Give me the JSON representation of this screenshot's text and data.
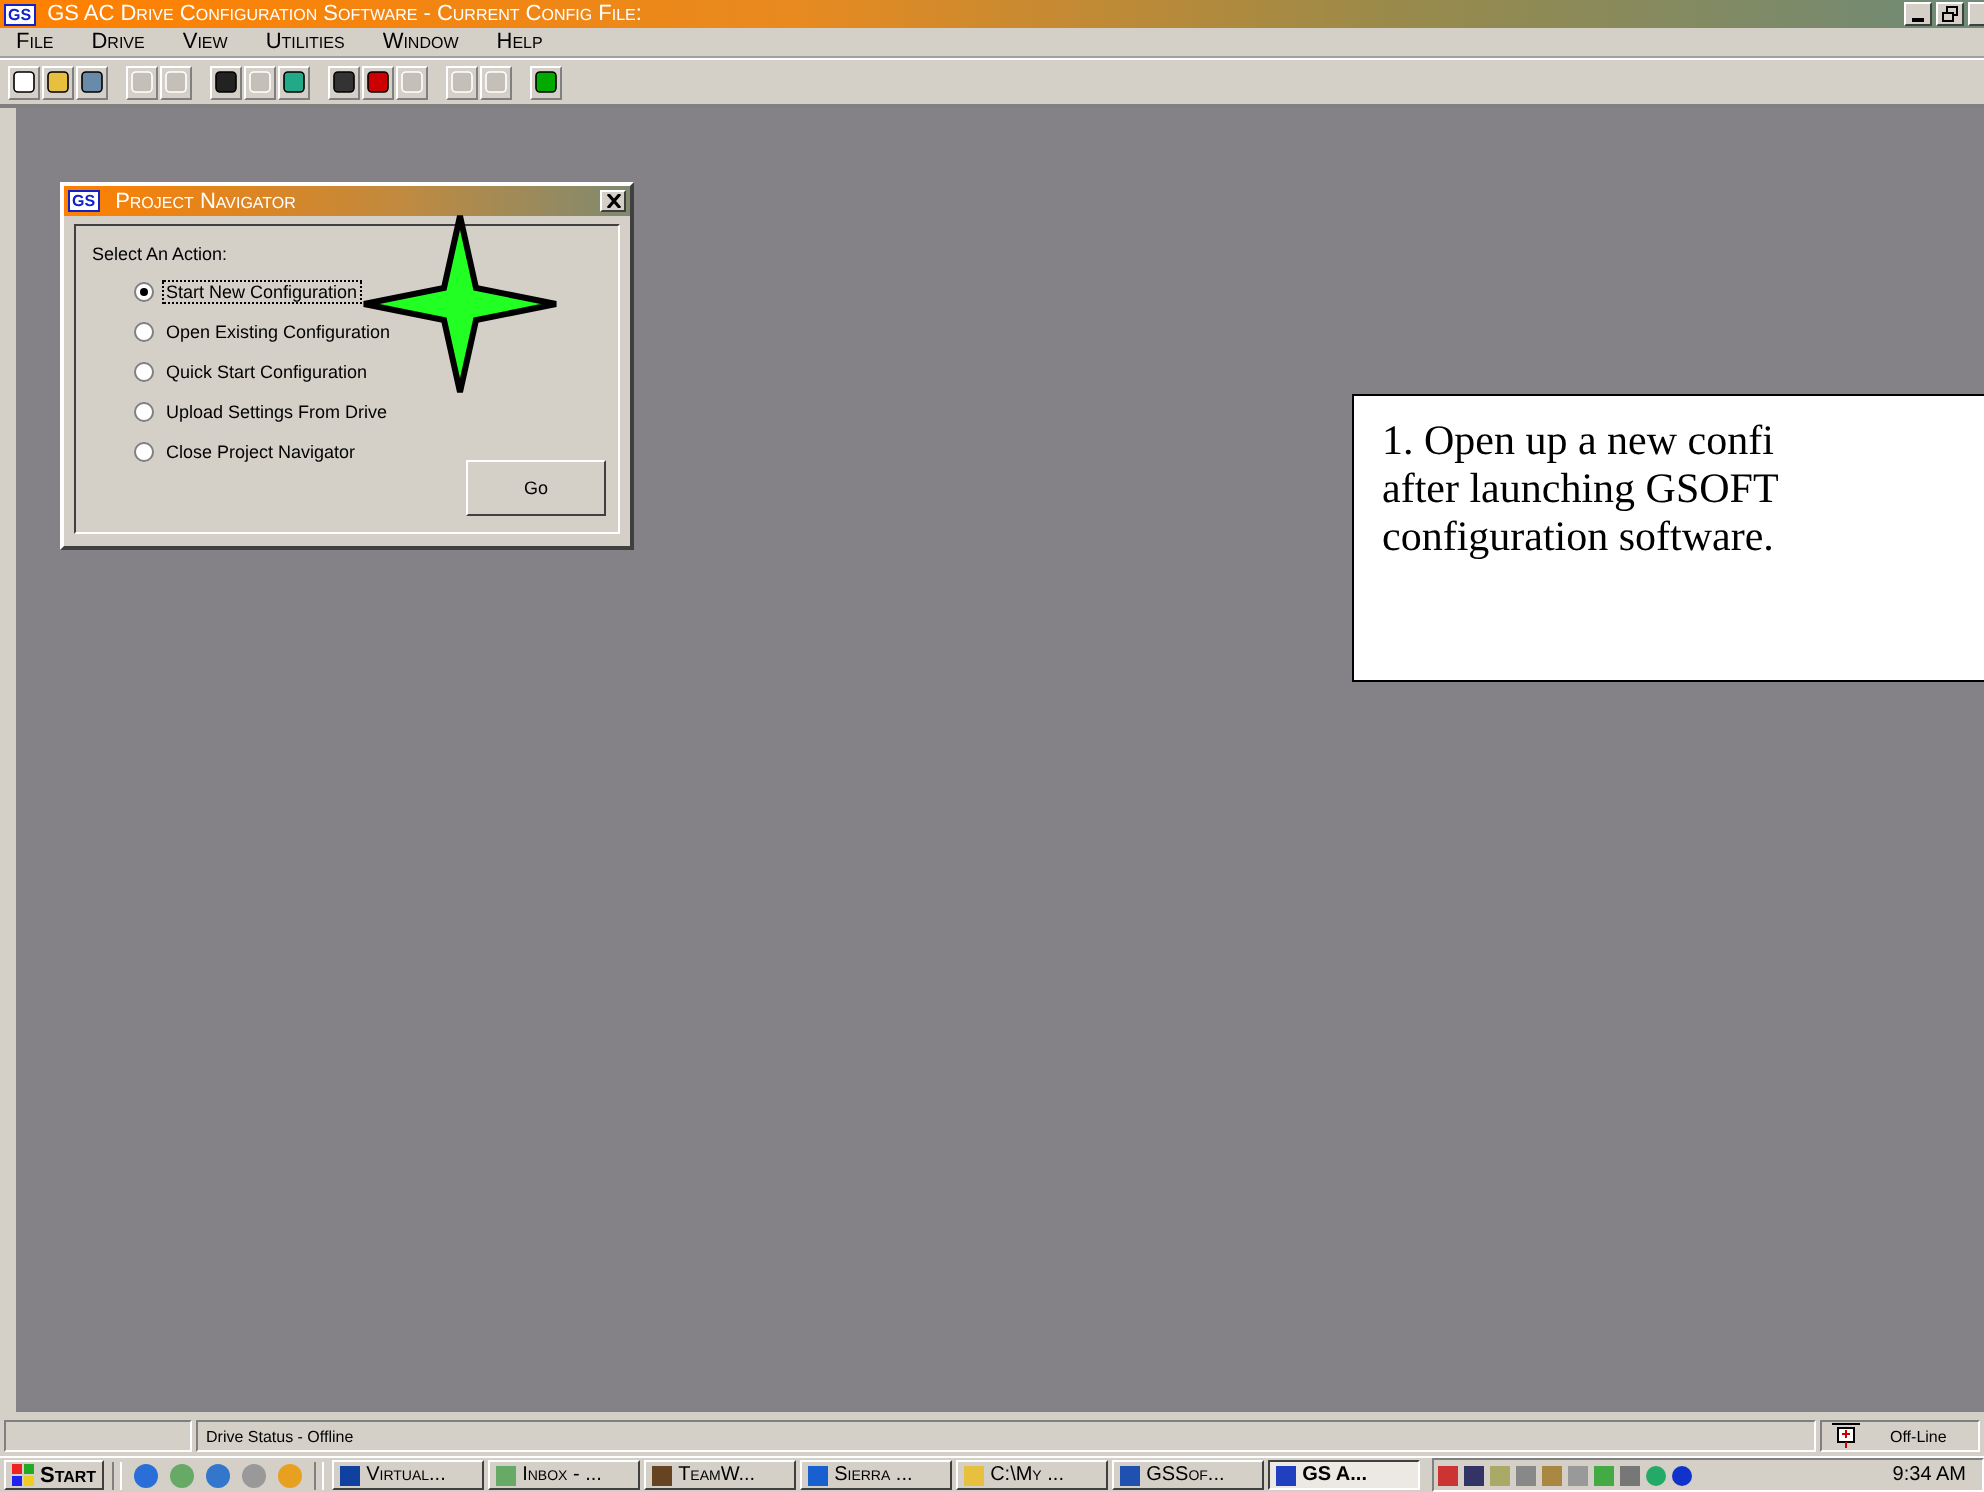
{
  "window": {
    "logo": "GS",
    "title": "GS AC Drive Configuration Software - Current Config File:"
  },
  "menu": [
    "File",
    "Drive",
    "View",
    "Utilities",
    "Window",
    "Help"
  ],
  "toolbar": [
    {
      "disabled": false
    },
    {
      "disabled": false
    },
    {
      "disabled": false
    },
    {
      "disabled": true
    },
    {
      "disabled": true
    },
    {
      "disabled": false
    },
    {
      "disabled": true
    },
    {
      "disabled": false
    },
    {
      "disabled": false
    },
    {
      "disabled": false
    },
    {
      "disabled": true
    },
    {
      "disabled": true
    },
    {
      "disabled": true
    },
    {
      "disabled": false
    }
  ],
  "dialog": {
    "logo": "GS",
    "title": "Project Navigator",
    "prompt": "Select An Action:",
    "options": [
      {
        "label": "Start New Configuration",
        "selected": true
      },
      {
        "label": "Open Existing Configuration",
        "selected": false
      },
      {
        "label": "Quick Start Configuration",
        "selected": false
      },
      {
        "label": "Upload Settings From Drive",
        "selected": false
      },
      {
        "label": "Close Project Navigator",
        "selected": false
      }
    ],
    "button": "Go"
  },
  "callout": {
    "lines": [
      "1. Open up a new confi",
      "after launching GSOFT",
      "configuration software."
    ]
  },
  "status_bar": {
    "status": "Drive Status - Offline",
    "connection": "Off-Line"
  },
  "taskbar": {
    "start": "Start",
    "tasks": [
      {
        "label": "Virtual...",
        "selected": false
      },
      {
        "label": "Inbox - ...",
        "selected": false
      },
      {
        "label": "TeamW...",
        "selected": false
      },
      {
        "label": "Sierra ...",
        "selected": false
      },
      {
        "label": "C:\\My ...",
        "selected": false
      },
      {
        "label": "GSSof...",
        "selected": false
      },
      {
        "label": "GS A...",
        "selected": true
      }
    ],
    "clock": "9:34 AM"
  }
}
